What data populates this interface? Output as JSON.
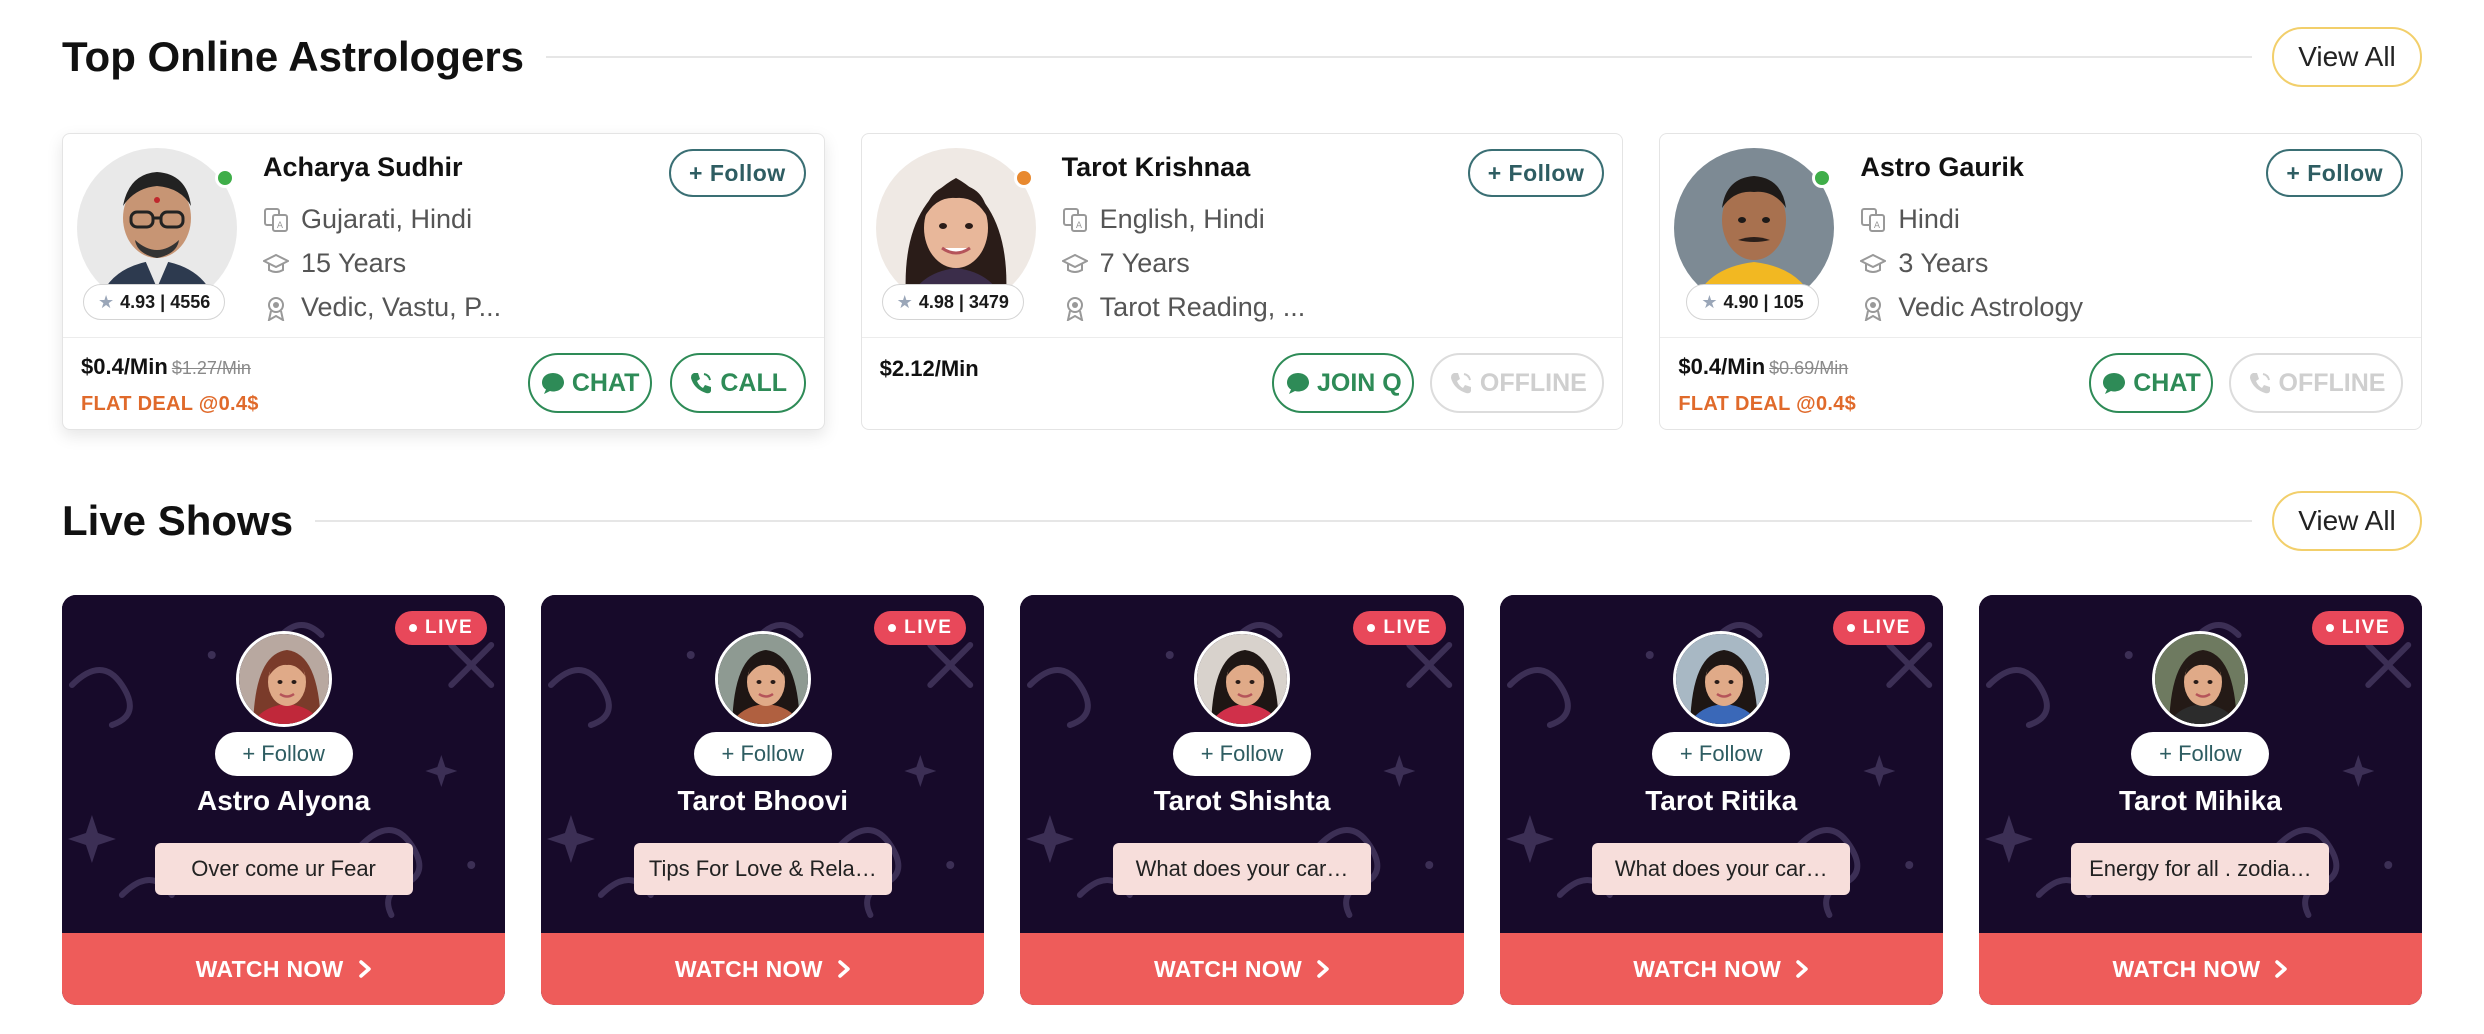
{
  "top_astrologers": {
    "title": "Top Online Astrologers",
    "view_all": "View All",
    "cards": [
      {
        "name": "Acharya Sudhir",
        "follow": "+ Follow",
        "languages": "Gujarati, Hindi",
        "experience": "15 Years",
        "skills": "Vedic, Vastu, P...",
        "rating": "4.93 | 4556",
        "status_color": "#3fae49",
        "price": "$0.4/Min",
        "old_price": "$1.27/Min",
        "deal": "FLAT DEAL @0.4$",
        "buttons": [
          {
            "label": "CHAT",
            "state": "active"
          },
          {
            "label": "CALL",
            "state": "active"
          }
        ]
      },
      {
        "name": "Tarot Krishnaa",
        "follow": "+ Follow",
        "languages": "English, Hindi",
        "experience": "7 Years",
        "skills": "Tarot Reading, ...",
        "rating": "4.98 | 3479",
        "status_color": "#e8892f",
        "price": "$2.12/Min",
        "old_price": "",
        "deal": "",
        "buttons": [
          {
            "label": "JOIN Q",
            "state": "active"
          },
          {
            "label": "OFFLINE",
            "state": "disabled"
          }
        ]
      },
      {
        "name": "Astro Gaurik",
        "follow": "+ Follow",
        "languages": "Hindi",
        "experience": "3 Years",
        "skills": "Vedic Astrology",
        "rating": "4.90 | 105",
        "status_color": "#3fae49",
        "price": "$0.4/Min",
        "old_price": "$0.69/Min",
        "deal": "FLAT DEAL @0.4$",
        "buttons": [
          {
            "label": "CHAT",
            "state": "active"
          },
          {
            "label": "OFFLINE",
            "state": "disabled"
          }
        ]
      }
    ]
  },
  "live_shows": {
    "title": "Live Shows",
    "view_all": "View All",
    "badge": "LIVE",
    "follow": "+ Follow",
    "watch": "WATCH NOW",
    "cards": [
      {
        "name": "Astro Alyona",
        "topic": "Over come ur Fear"
      },
      {
        "name": "Tarot Bhoovi",
        "topic": "Tips For Love & Rela…"
      },
      {
        "name": "Tarot Shishta",
        "topic": "What does your car…"
      },
      {
        "name": "Tarot Ritika",
        "topic": "What does your car…"
      },
      {
        "name": "Tarot Mihika",
        "topic": "Energy for all . zodia…"
      }
    ]
  },
  "colors": {
    "accent_green": "#2e8b57",
    "follow_teal": "#2e5d62",
    "deal_orange": "#e06a2b",
    "live_red": "#e8485a",
    "watch_red": "#ee5c5a",
    "live_bg": "#170a2a",
    "view_all_border": "#f2cf6b"
  }
}
